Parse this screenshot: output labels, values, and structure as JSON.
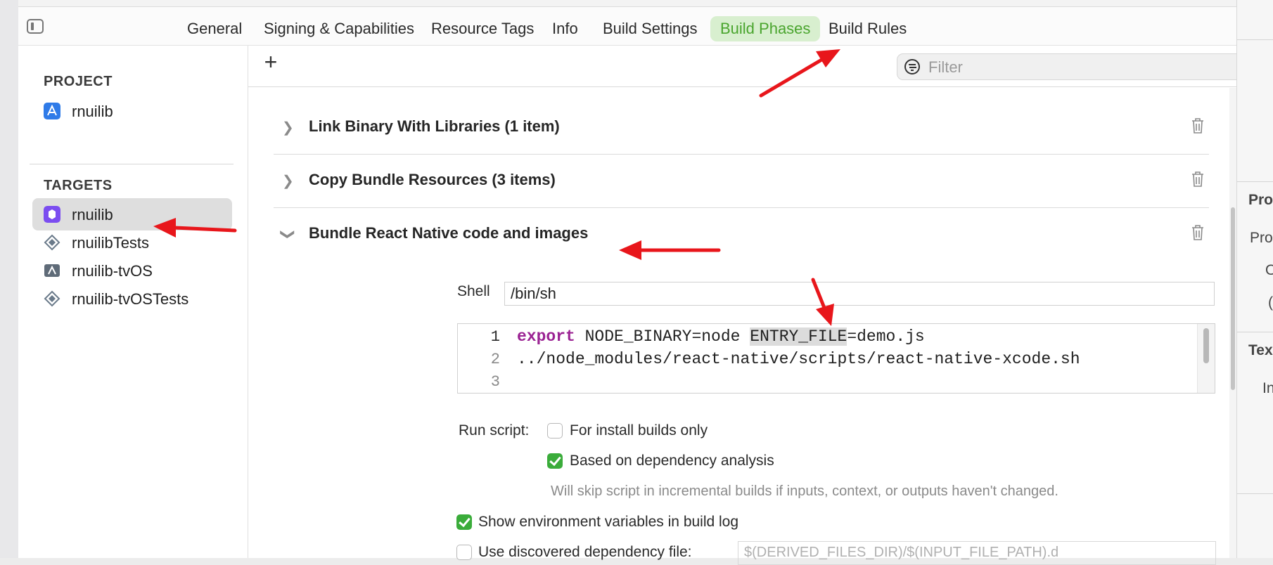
{
  "tabs": {
    "items": [
      "General",
      "Signing & Capabilities",
      "Resource Tags",
      "Info",
      "Build Settings",
      "Build Phases",
      "Build Rules"
    ],
    "active": "Build Phases"
  },
  "sidebar": {
    "project_heading": "PROJECT",
    "project_item": "rnuilib",
    "targets_heading": "TARGETS",
    "targets": [
      "rnuilib",
      "rnuilibTests",
      "rnuilib-tvOS",
      "rnuilib-tvOSTests"
    ],
    "selected_target": "rnuilib"
  },
  "toolbar": {
    "add_label": "+",
    "filter_placeholder": "Filter"
  },
  "phases": [
    {
      "title": "Link Binary With Libraries (1 item)",
      "expanded": false
    },
    {
      "title": "Copy Bundle Resources (3 items)",
      "expanded": false
    },
    {
      "title": "Bundle React Native code and images",
      "expanded": true
    }
  ],
  "script": {
    "shell_label": "Shell",
    "shell_value": "/bin/sh",
    "line_numbers": [
      "1",
      "2",
      "3"
    ],
    "line1_keyword": "export",
    "line1_pre": " NODE_BINARY=node ",
    "line1_highlight": "ENTRY_FILE",
    "line1_post": "=demo.js",
    "line2": "../node_modules/react-native/scripts/react-native-xcode.sh"
  },
  "run_script": {
    "label": "Run script:",
    "install_builds_only": {
      "label": "For install builds only",
      "checked": false
    },
    "dependency_analysis": {
      "label": "Based on dependency analysis",
      "checked": true
    },
    "note": "Will skip script in incremental builds if inputs, context, or outputs haven't changed.",
    "show_env_vars": {
      "label": "Show environment variables in build log",
      "checked": true
    },
    "discovered_dep_file": {
      "label": "Use discovered dependency file:",
      "checked": false
    },
    "dep_file_placeholder": "$(DERIVED_FILES_DIR)/$(INPUT_FILE_PATH).d"
  },
  "inspector": {
    "fragments": [
      "Pro",
      "Pro",
      "O",
      "(",
      "Tex",
      "In"
    ]
  },
  "colors": {
    "active_tab_bg": "#d8efcf",
    "active_tab_text": "#4aa52e",
    "checkbox_on": "#3aac3a",
    "keyword": "#9b2393",
    "annotation_arrow": "#e8161b"
  }
}
